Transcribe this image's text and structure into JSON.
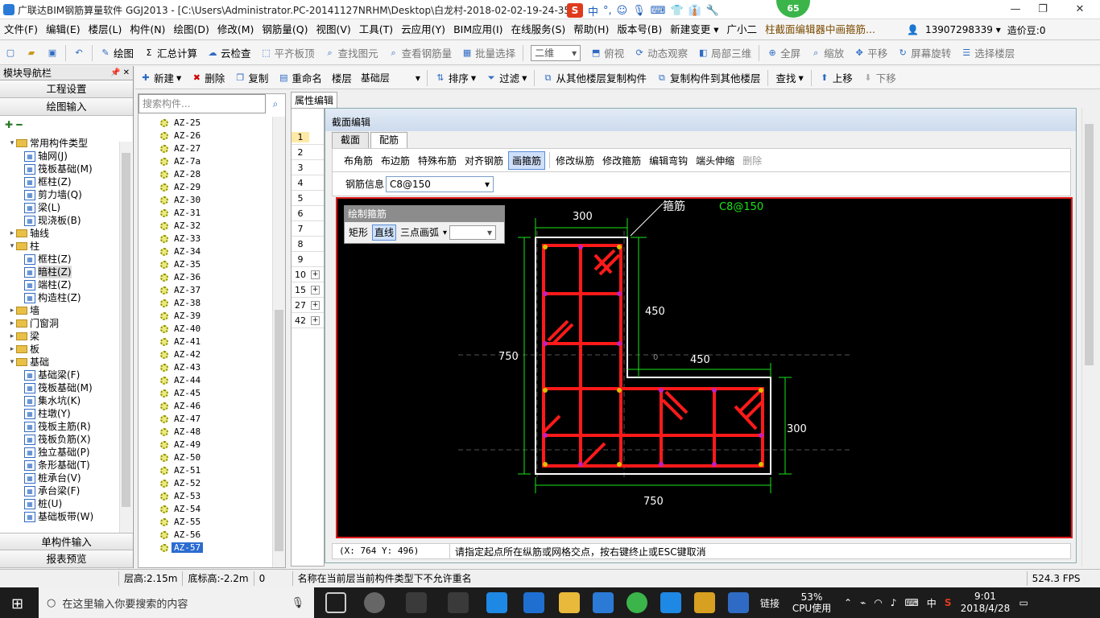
{
  "window": {
    "title": "广联达BIM钢筋算量软件 GGJ2013 - [C:\\Users\\Administrator.PC-20141127NRHM\\Desktop\\白龙村-2018-02-02-19-24-35",
    "badge": "65",
    "min": "—",
    "max": "❐",
    "close": "✕"
  },
  "ime": {
    "s": "S",
    "items": [
      "中",
      "°,",
      "☺",
      "🎙",
      "⌨",
      "👕",
      "👔",
      "🔧"
    ]
  },
  "menu": [
    "文件(F)",
    "编辑(E)",
    "楼层(L)",
    "构件(N)",
    "绘图(D)",
    "修改(M)",
    "钢筋量(Q)",
    "视图(V)",
    "工具(T)",
    "云应用(Y)",
    "BIM应用(I)",
    "在线服务(S)",
    "帮助(H)",
    "版本号(B)",
    "新建变更 ▾",
    "广小二",
    "柱截面编辑器中画箍筋..."
  ],
  "menu_right": {
    "phone": "13907298339 ▾",
    "price": "造价豆:0"
  },
  "toolbar1": {
    "draw": "绘图",
    "sum": "汇总计算",
    "cloud": "云检查",
    "flat": "平齐板顶",
    "find": "查找图元",
    "viewq": "查看钢筋量",
    "batch": "批量选择",
    "view2d": "二维",
    "ortho": "俯视",
    "dyn": "动态观察",
    "local3d": "局部三维",
    "full": "全屏",
    "zoom": "缩放",
    "pan": "平移",
    "rotate": "屏幕旋转",
    "floor": "选择楼层"
  },
  "nav": {
    "title": "模块导航栏",
    "pin": "📌 ✕",
    "project": "工程设置",
    "drawinput": "绘图输入",
    "single": "单构件输入",
    "report": "报表预览",
    "tree": [
      {
        "t": "常用构件类型",
        "lvl": 0,
        "exp": "▾",
        "k": "fold"
      },
      {
        "t": "轴网(J)",
        "lvl": 1,
        "k": "ic"
      },
      {
        "t": "筏板基础(M)",
        "lvl": 1,
        "k": "ic"
      },
      {
        "t": "框柱(Z)",
        "lvl": 1,
        "k": "ic"
      },
      {
        "t": "剪力墙(Q)",
        "lvl": 1,
        "k": "ic"
      },
      {
        "t": "梁(L)",
        "lvl": 1,
        "k": "ic"
      },
      {
        "t": "现浇板(B)",
        "lvl": 1,
        "k": "ic"
      },
      {
        "t": "轴线",
        "lvl": 0,
        "exp": "▸",
        "k": "fold"
      },
      {
        "t": "柱",
        "lvl": 0,
        "exp": "▾",
        "k": "fold"
      },
      {
        "t": "框柱(Z)",
        "lvl": 1,
        "k": "ic"
      },
      {
        "t": "暗柱(Z)",
        "lvl": 1,
        "k": "ic",
        "sel": true
      },
      {
        "t": "端柱(Z)",
        "lvl": 1,
        "k": "ic"
      },
      {
        "t": "构造柱(Z)",
        "lvl": 1,
        "k": "ic"
      },
      {
        "t": "墙",
        "lvl": 0,
        "exp": "▸",
        "k": "fold"
      },
      {
        "t": "门窗洞",
        "lvl": 0,
        "exp": "▸",
        "k": "fold"
      },
      {
        "t": "梁",
        "lvl": 0,
        "exp": "▸",
        "k": "fold"
      },
      {
        "t": "板",
        "lvl": 0,
        "exp": "▸",
        "k": "fold"
      },
      {
        "t": "基础",
        "lvl": 0,
        "exp": "▾",
        "k": "fold"
      },
      {
        "t": "基础梁(F)",
        "lvl": 1,
        "k": "ic"
      },
      {
        "t": "筏板基础(M)",
        "lvl": 1,
        "k": "ic"
      },
      {
        "t": "集水坑(K)",
        "lvl": 1,
        "k": "ic"
      },
      {
        "t": "柱墩(Y)",
        "lvl": 1,
        "k": "ic"
      },
      {
        "t": "筏板主筋(R)",
        "lvl": 1,
        "k": "ic"
      },
      {
        "t": "筏板负筋(X)",
        "lvl": 1,
        "k": "ic"
      },
      {
        "t": "独立基础(P)",
        "lvl": 1,
        "k": "ic"
      },
      {
        "t": "条形基础(T)",
        "lvl": 1,
        "k": "ic"
      },
      {
        "t": "桩承台(V)",
        "lvl": 1,
        "k": "ic"
      },
      {
        "t": "承台梁(F)",
        "lvl": 1,
        "k": "ic"
      },
      {
        "t": "桩(U)",
        "lvl": 1,
        "k": "ic"
      },
      {
        "t": "基础板带(W)",
        "lvl": 1,
        "k": "ic"
      }
    ]
  },
  "comp_toolbar": {
    "new": "新建",
    "del": "删除",
    "copy": "复制",
    "rename": "重命名",
    "floor_label": "楼层",
    "floor_val": "基础层",
    "sort": "排序",
    "filter": "过滤",
    "copyfrom": "从其他楼层复制构件",
    "copyto": "复制构件到其他楼层",
    "find": "查找",
    "up": "上移",
    "down": "下移"
  },
  "search_placeholder": "搜索构件...",
  "components": [
    "AZ-25",
    "AZ-26",
    "AZ-27",
    "AZ-7a",
    "AZ-28",
    "AZ-29",
    "AZ-30",
    "AZ-31",
    "AZ-32",
    "AZ-33",
    "AZ-34",
    "AZ-35",
    "AZ-36",
    "AZ-37",
    "AZ-38",
    "AZ-39",
    "AZ-40",
    "AZ-41",
    "AZ-42",
    "AZ-43",
    "AZ-44",
    "AZ-45",
    "AZ-46",
    "AZ-47",
    "AZ-48",
    "AZ-49",
    "AZ-50",
    "AZ-51",
    "AZ-52",
    "AZ-53",
    "AZ-54",
    "AZ-55",
    "AZ-56",
    "AZ-57"
  ],
  "prop_tab": "属性编辑",
  "grid_rows": [
    {
      "n": "1",
      "sel": true
    },
    {
      "n": "2"
    },
    {
      "n": "3"
    },
    {
      "n": "4"
    },
    {
      "n": "5"
    },
    {
      "n": "6"
    },
    {
      "n": "7"
    },
    {
      "n": "8"
    },
    {
      "n": "9"
    },
    {
      "n": "10",
      "plus": true
    },
    {
      "n": "15",
      "plus": true
    },
    {
      "n": "27",
      "plus": true
    },
    {
      "n": "42",
      "plus": true
    }
  ],
  "editor": {
    "caption": "截面编辑",
    "tabs": [
      "截面",
      "配筋"
    ],
    "tab_active": 1,
    "buttons": [
      "布角筋",
      "布边筋",
      "特殊布筋",
      "对齐钢筋",
      "画箍筋",
      "修改纵筋",
      "修改箍筋",
      "编辑弯钩",
      "端头伸缩",
      "删除"
    ],
    "rebar_label": "钢筋信息",
    "rebar_value": "C8@150",
    "draw_title": "绘制箍筋",
    "draw_rect": "矩形",
    "draw_line": "直线",
    "draw_arc": "三点画弧",
    "coord": "(X: 764 Y: 496)",
    "msg": "请指定起点所在纵筋或网格交点，按右键终止或ESC键取消"
  },
  "drawing": {
    "label_stirrup": "箍筋",
    "label_spec": "C8@150",
    "dims": [
      "300",
      "450",
      "450",
      "300",
      "750",
      "750"
    ],
    "hint": "0"
  },
  "status": {
    "h": "层高:2.15m",
    "b": "底标高:-2.2m",
    "n": "0",
    "msg": "名称在当前层当前构件类型下不允许重名",
    "fps": "524.3 FPS"
  },
  "taskbar": {
    "search": "在这里输入你要搜索的内容",
    "link": "链接",
    "cpu": "53%",
    "cpu_label": "CPU使用",
    "ime": "中",
    "time": "9:01",
    "date": "2018/4/28"
  },
  "colors": {
    "stirrup": "#ff1a1a",
    "dim": "#19e619",
    "outline": "#ffffff",
    "accent": "#2b6cd0"
  }
}
